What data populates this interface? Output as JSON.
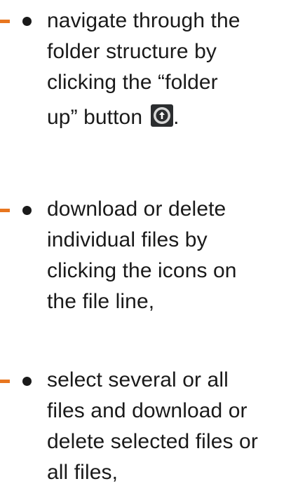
{
  "items": [
    {
      "lines": [
        "navigate through the",
        "folder structure by",
        "clicking the “folder",
        "up” button"
      ],
      "suffix": ".",
      "icon": "folder-up-icon"
    },
    {
      "lines": [
        "download or delete",
        "individual files by",
        "clicking the icons on",
        "the file line,"
      ]
    },
    {
      "lines": [
        "select several or all",
        "files and download or",
        "delete selected files or",
        "all files,"
      ]
    }
  ],
  "colors": {
    "accent": "#e8761f",
    "text": "#1a1a1a",
    "icon_bg": "#2b2d2f",
    "icon_circle": "#d9d9d9"
  }
}
